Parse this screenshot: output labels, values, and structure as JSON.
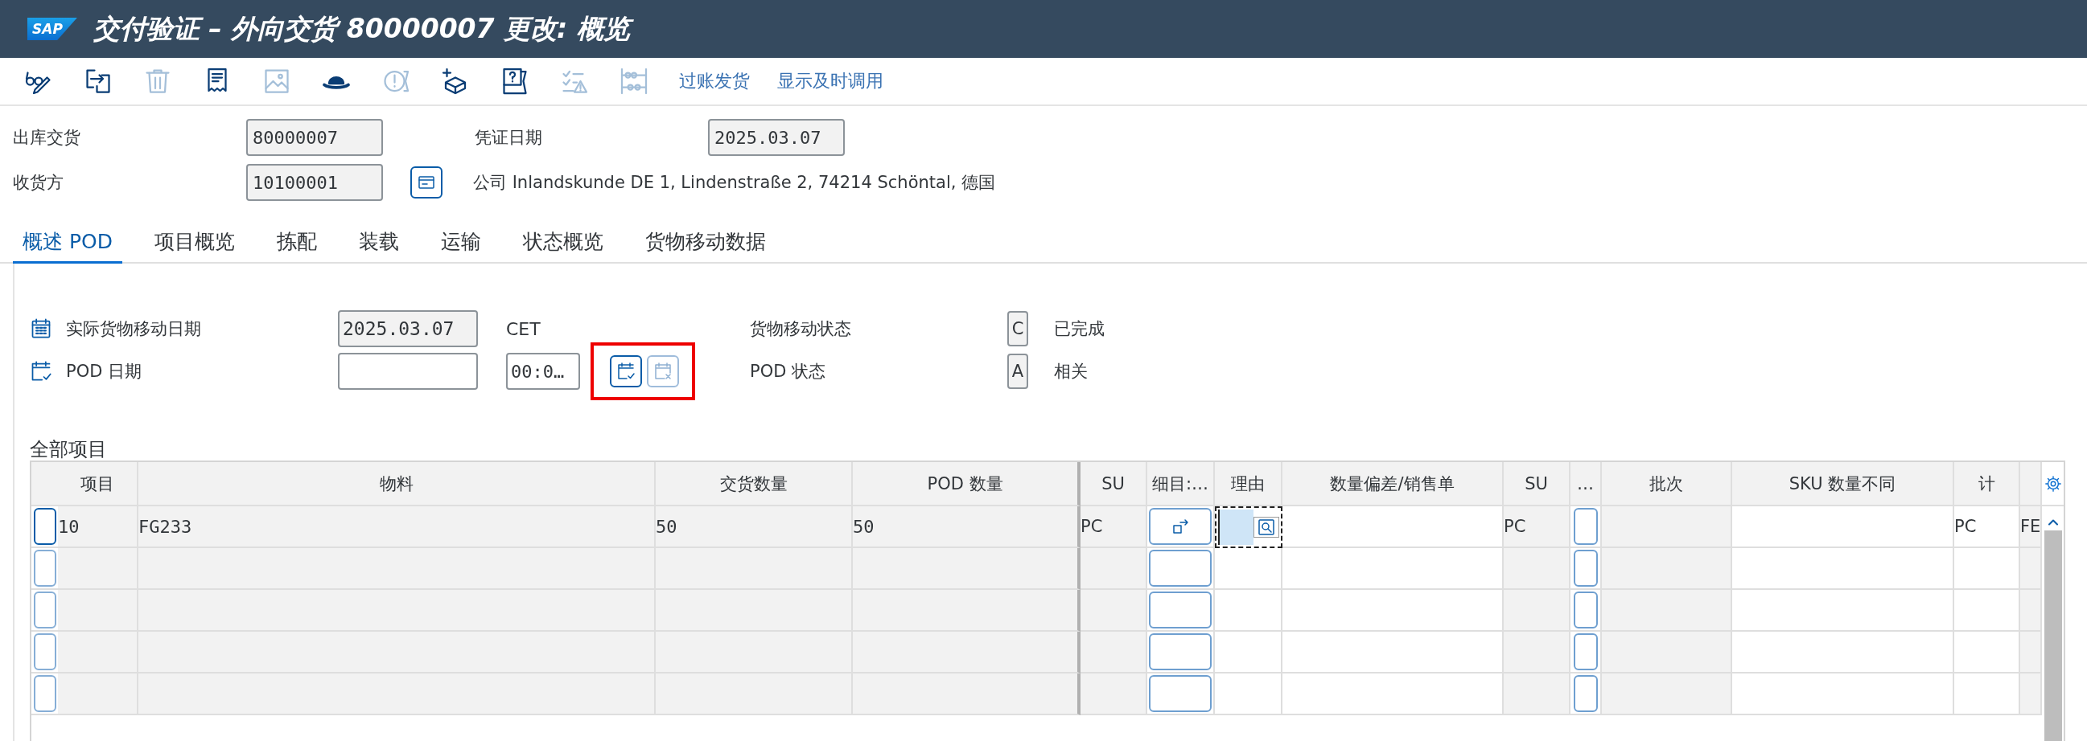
{
  "window": {
    "logo": "SAP",
    "title": "交付验证 – 外向交货 80000007 更改: 概览"
  },
  "toolbar": {
    "icons": [
      {
        "kind": "glasses-pen",
        "disabled": false
      },
      {
        "kind": "exit",
        "disabled": false
      },
      {
        "kind": "trash",
        "disabled": true
      },
      {
        "kind": "document",
        "disabled": false
      },
      {
        "kind": "image",
        "disabled": true
      },
      {
        "kind": "hat",
        "disabled": false
      },
      {
        "kind": "alert-scroll",
        "disabled": true
      },
      {
        "kind": "add-box",
        "disabled": false
      },
      {
        "kind": "help-scroll",
        "disabled": false
      },
      {
        "kind": "checklist-warning",
        "disabled": true
      },
      {
        "kind": "abacus",
        "disabled": true
      }
    ],
    "buttons": [
      "过账发货",
      "显示及时调用"
    ]
  },
  "header": {
    "outbound_delivery": {
      "label": "出库交货",
      "value": "80000007"
    },
    "document_date": {
      "label": "凭证日期",
      "value": "2025.03.07"
    },
    "ship_to": {
      "label": "收货方",
      "value": "10100001",
      "description": "公司 Inlandskunde DE 1, Lindenstraße 2, 74214 Schöntal, 德国"
    }
  },
  "tabs": [
    {
      "label": "概述 POD",
      "selected": true
    },
    {
      "label": "项目概览",
      "selected": false
    },
    {
      "label": "拣配",
      "selected": false
    },
    {
      "label": "装载",
      "selected": false
    },
    {
      "label": "运输",
      "selected": false
    },
    {
      "label": "状态概览",
      "selected": false
    },
    {
      "label": "货物移动数据",
      "selected": false
    }
  ],
  "pod": {
    "actual_gi_date": {
      "label": "实际货物移动日期",
      "value": "2025.03.07",
      "readonly": true,
      "timezone": "CET"
    },
    "pod_date": {
      "label": "POD 日期",
      "readonly": false,
      "time": "00:0…"
    },
    "pod_buttons": [
      {
        "kind": "calendar-check",
        "disabled": false
      },
      {
        "kind": "calendar-clear",
        "disabled": true
      }
    ],
    "highlighted": true,
    "gm_status": {
      "label": "货物移动状态",
      "code": "C",
      "text": "已完成"
    },
    "pod_status": {
      "label": "POD 状态",
      "code": "A",
      "text": "相关"
    }
  },
  "items_table": {
    "title": "全部项目",
    "columns": [
      {
        "kind": "selector",
        "editable": true
      },
      {
        "label": "项目",
        "kind": "text",
        "editable": false
      },
      {
        "label": "物料",
        "kind": "text",
        "editable": false
      },
      {
        "label": "交货数量",
        "kind": "text",
        "editable": false
      },
      {
        "label": "POD 数量",
        "kind": "text",
        "editable": false
      },
      {
        "label": "SU",
        "kind": "text",
        "editable": false
      },
      {
        "label": "细目:…",
        "kind": "button",
        "editable": true
      },
      {
        "label": "理由",
        "kind": "input",
        "editable": true
      },
      {
        "label": "数量偏差/销售单",
        "kind": "text",
        "editable": true
      },
      {
        "label": "SU",
        "kind": "text",
        "editable": false
      },
      {
        "label": "…",
        "kind": "small-button",
        "editable": true
      },
      {
        "label": "批次",
        "kind": "text",
        "editable": false
      },
      {
        "label": "SKU 数量不同",
        "kind": "text",
        "editable": true
      },
      {
        "label": "计",
        "kind": "text",
        "editable": true
      },
      {
        "kind": "text",
        "editable": false
      }
    ],
    "rows": [
      {
        "focused": true,
        "item": "10",
        "material": "FG233",
        "delivery_qty": "50",
        "pod_qty": "50",
        "su": "PC",
        "su_2": "PC",
        "column_14": "PC",
        "column_15": "FE"
      }
    ]
  }
}
